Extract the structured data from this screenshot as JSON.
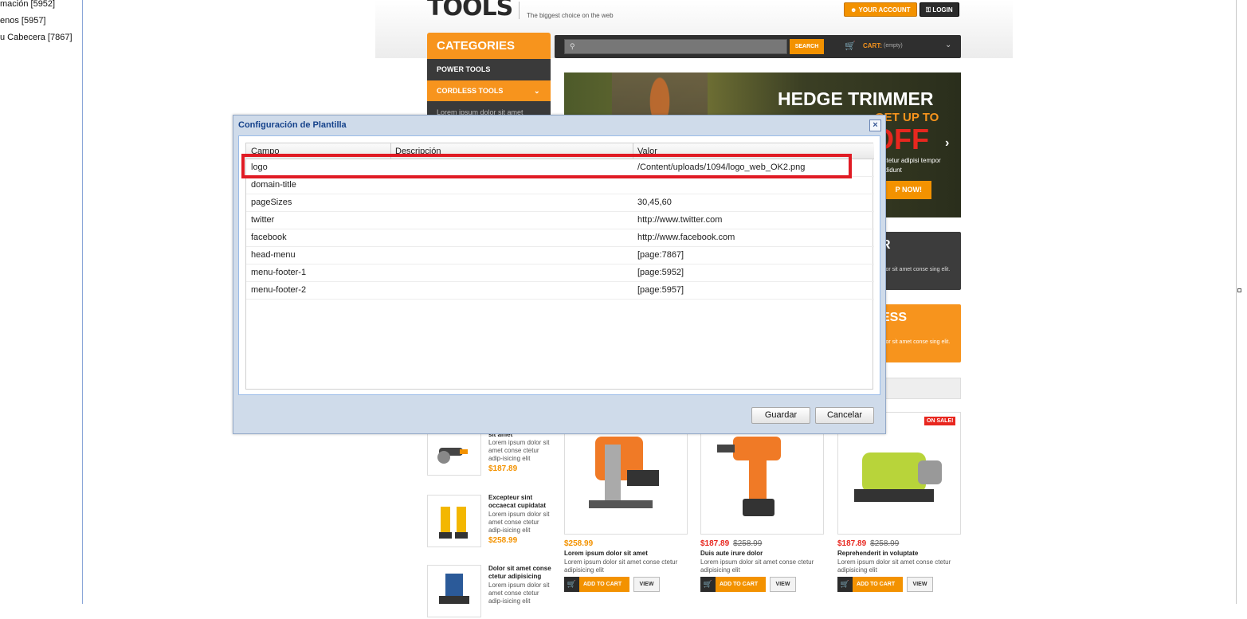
{
  "tree": {
    "items": [
      "mación [5952]",
      "enos [5957]",
      "u Cabecera [7867]"
    ]
  },
  "store": {
    "logo": "TOOLS",
    "tagline": "The biggest choice on the web",
    "account_label": "YOUR ACCOUNT",
    "login_label": "LOGIN",
    "categories_title": "CATEGORIES",
    "categories": [
      "POWER TOOLS",
      "CORDLESS TOOLS",
      "Lorem ipsum dolor sit amet"
    ],
    "search_button": "SEARCH",
    "cart_label": "CART:",
    "cart_status": "(empty)",
    "hero": {
      "title": "HEDGE TRIMMER",
      "subtitle": "GET UP TO",
      "off": "OFF",
      "text": "se ctetur adipisi tempor incididunt",
      "button": "P NOW!"
    },
    "promo1": {
      "title": "R",
      "text": "olor sit amet conse sing elit."
    },
    "promo2": {
      "title": "ESS",
      "text": "olor sit amet conse sing elit."
    },
    "side_products": [
      {
        "title": "sit amet",
        "desc": "Lorem ipsum dolor sit amet conse ctetur adip-isicing elit",
        "price": "$187.89"
      },
      {
        "title": "Excepteur sint occaecat cupidatat",
        "desc": "Lorem ipsum dolor sit amet conse ctetur adip-isicing elit",
        "price": "$258.99"
      },
      {
        "title": "Dolor sit amet conse ctetur adipisicing",
        "desc": "Lorem ipsum dolor sit amet conse ctetur adip-isicing elit",
        "price": ""
      }
    ],
    "products": [
      {
        "price": "$258.99",
        "old_price": "",
        "title": "Lorem ipsum dolor sit amet",
        "desc": "Lorem ipsum dolor sit amet conse ctetur adipisicing elit"
      },
      {
        "price": "$187.89",
        "old_price": "$258.99",
        "title": "Duis aute irure dolor",
        "desc": "Lorem ipsum dolor sit amet conse ctetur adipisicing elit"
      },
      {
        "price": "$187.89",
        "old_price": "$258.99",
        "title": "Reprehenderit in voluptate",
        "desc": "Lorem ipsum dolor sit amet conse ctetur adipisicing elit"
      }
    ],
    "add_to_cart": "ADD TO CART",
    "view": "VIEW",
    "on_sale": "ON SALE!"
  },
  "dialog": {
    "title": "Configuración de Plantilla",
    "columns": [
      "Campo",
      "Descripción",
      "Valor"
    ],
    "rows": [
      {
        "campo": "logo",
        "descripcion": "",
        "valor": "/Content/uploads/1094/logo_web_OK2.png"
      },
      {
        "campo": "domain-title",
        "descripcion": "",
        "valor": ""
      },
      {
        "campo": "pageSizes",
        "descripcion": "",
        "valor": "30,45,60"
      },
      {
        "campo": "twitter",
        "descripcion": "",
        "valor": "http://www.twitter.com"
      },
      {
        "campo": "facebook",
        "descripcion": "",
        "valor": "http://www.facebook.com"
      },
      {
        "campo": "head-menu",
        "descripcion": "",
        "valor": "[page:7867]"
      },
      {
        "campo": "menu-footer-1",
        "descripcion": "",
        "valor": "[page:5952]"
      },
      {
        "campo": "menu-footer-2",
        "descripcion": "",
        "valor": "[page:5957]"
      }
    ],
    "save_label": "Guardar",
    "cancel_label": "Cancelar"
  },
  "colors": {
    "accent": "#f39200",
    "highlight": "#e01b24",
    "dialog_title": "#15428b"
  }
}
